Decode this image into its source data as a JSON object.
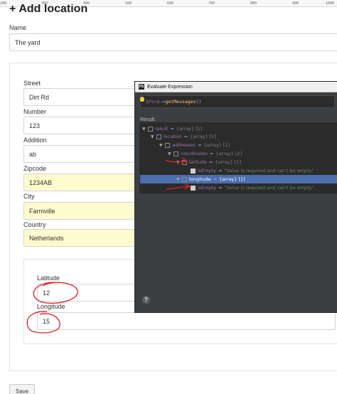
{
  "ruler": {
    "ticks": [
      "200",
      "300",
      "400",
      "500",
      "600",
      "700",
      "800",
      "900",
      "1000"
    ]
  },
  "page": {
    "title": "Add location",
    "title_icon": "plus-icon"
  },
  "form": {
    "name": {
      "label": "Name",
      "value": "The yard"
    },
    "street": {
      "label": "Street",
      "value": "Dirt Rd"
    },
    "number": {
      "label": "Number",
      "value": "123"
    },
    "addition": {
      "label": "Addition",
      "value": "ab"
    },
    "zipcode": {
      "label": "Zipcode",
      "value": "1234AB"
    },
    "city": {
      "label": "City",
      "value": "Farmville"
    },
    "country": {
      "label": "Country",
      "value": "Netherlands"
    },
    "latitude": {
      "label": "Latitude",
      "value": "12"
    },
    "longitude": {
      "label": "Longitude",
      "value": "15"
    },
    "save_label": "Save"
  },
  "dialog": {
    "title": "Evaluate Expression",
    "app_icon_text": "PS",
    "expression_var": "$form",
    "expression_rest": "->",
    "expression_method": "getMessages",
    "expression_end": "()",
    "result_label": "Result:",
    "tree": [
      {
        "key": "result",
        "value": "{array} [1]",
        "depth": 0
      },
      {
        "key": "location",
        "value": "{array} [1]",
        "depth": 1
      },
      {
        "key": "addresses",
        "value": "{array} [1]",
        "depth": 2
      },
      {
        "key": "coordinates",
        "value": "{array} [2]",
        "depth": 3
      },
      {
        "key": "latitude",
        "value": "{array} [1]",
        "depth": 4
      },
      {
        "key": "isEmpty",
        "value": "\"Value is required and can't be empty\"",
        "depth": 5,
        "leaf": true
      },
      {
        "key": "longitude",
        "value": "{array} [1]",
        "depth": 4,
        "selected": true
      },
      {
        "key": "isEmpty",
        "value": "\"Value is required and can't be empty\"",
        "depth": 5,
        "leaf": true
      }
    ],
    "equals": "=",
    "help": "?"
  },
  "colors": {
    "annotation": "#d9202a",
    "selection": "#4b6eaf",
    "dialog_bg": "#3c3f41",
    "required_field": "#fcfccf"
  }
}
